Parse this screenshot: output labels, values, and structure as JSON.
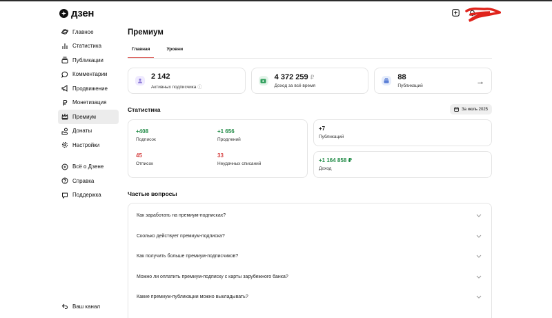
{
  "app": {
    "logo_text": "дзен"
  },
  "sidebar": {
    "items": [
      {
        "label": "Главное",
        "icon": "planet-icon"
      },
      {
        "label": "Статистика",
        "icon": "bar-chart-icon"
      },
      {
        "label": "Публикации",
        "icon": "stack-icon"
      },
      {
        "label": "Комментарии",
        "icon": "comment-icon"
      },
      {
        "label": "Продвижение",
        "icon": "megaphone-icon"
      },
      {
        "label": "Монетизация",
        "icon": "ruble-icon"
      },
      {
        "label": "Премиум",
        "icon": "crown-icon",
        "active": true
      },
      {
        "label": "Донаты",
        "icon": "donate-icon"
      },
      {
        "label": "Настройки",
        "icon": "gear-icon"
      }
    ],
    "secondary": [
      {
        "label": "Всё о Дзене",
        "icon": "zen-icon"
      },
      {
        "label": "Справка",
        "icon": "help-icon"
      },
      {
        "label": "Поддержка",
        "icon": "support-icon"
      }
    ],
    "bottom": {
      "label": "Ваш канал",
      "icon": "back-arrow-icon"
    }
  },
  "main": {
    "title": "Премиум",
    "tabs": [
      {
        "label": "Главная",
        "active": true
      },
      {
        "label": "Уровни",
        "active": false
      }
    ],
    "stat_cards": [
      {
        "value": "2 142",
        "label": "Активных подписчика",
        "info": "ⓘ",
        "icon": "subscribers-icon",
        "color": "#8a78d6"
      },
      {
        "value": "4 372 259",
        "currency": "₽",
        "label": "Доход за всё время",
        "icon": "money-icon",
        "color": "#2e9e5b"
      },
      {
        "value": "88",
        "label": "Публикаций",
        "icon": "publications-icon",
        "color": "#5b7fd6",
        "arrow": "→"
      }
    ],
    "stats": {
      "title": "Статистика",
      "period": "За июль 2025",
      "metrics": [
        {
          "value": "+408",
          "label": "Подписок",
          "tone": "green"
        },
        {
          "value": "+1 656",
          "label": "Продлений",
          "tone": "green"
        },
        {
          "value": "45",
          "label": "Отписок",
          "tone": "red"
        },
        {
          "value": "33",
          "label": "Неудачных списаний",
          "tone": "red"
        }
      ],
      "side": [
        {
          "value": "+7",
          "label": "Публикаций",
          "tone": "default"
        },
        {
          "value": "+1 164 858 ₽",
          "label": "Доход",
          "tone": "green"
        }
      ]
    },
    "faq": {
      "title": "Частые вопросы",
      "items": [
        "Как заработать на премиум-подписках?",
        "Сколько действует премиум-подписка?",
        "Как получить больше премиум-подписчиков?",
        "Можно ли оплатить премиум-подписку с карты зарубежного банка?",
        "Какие премиум-публикации можно выкладывать?"
      ]
    }
  }
}
